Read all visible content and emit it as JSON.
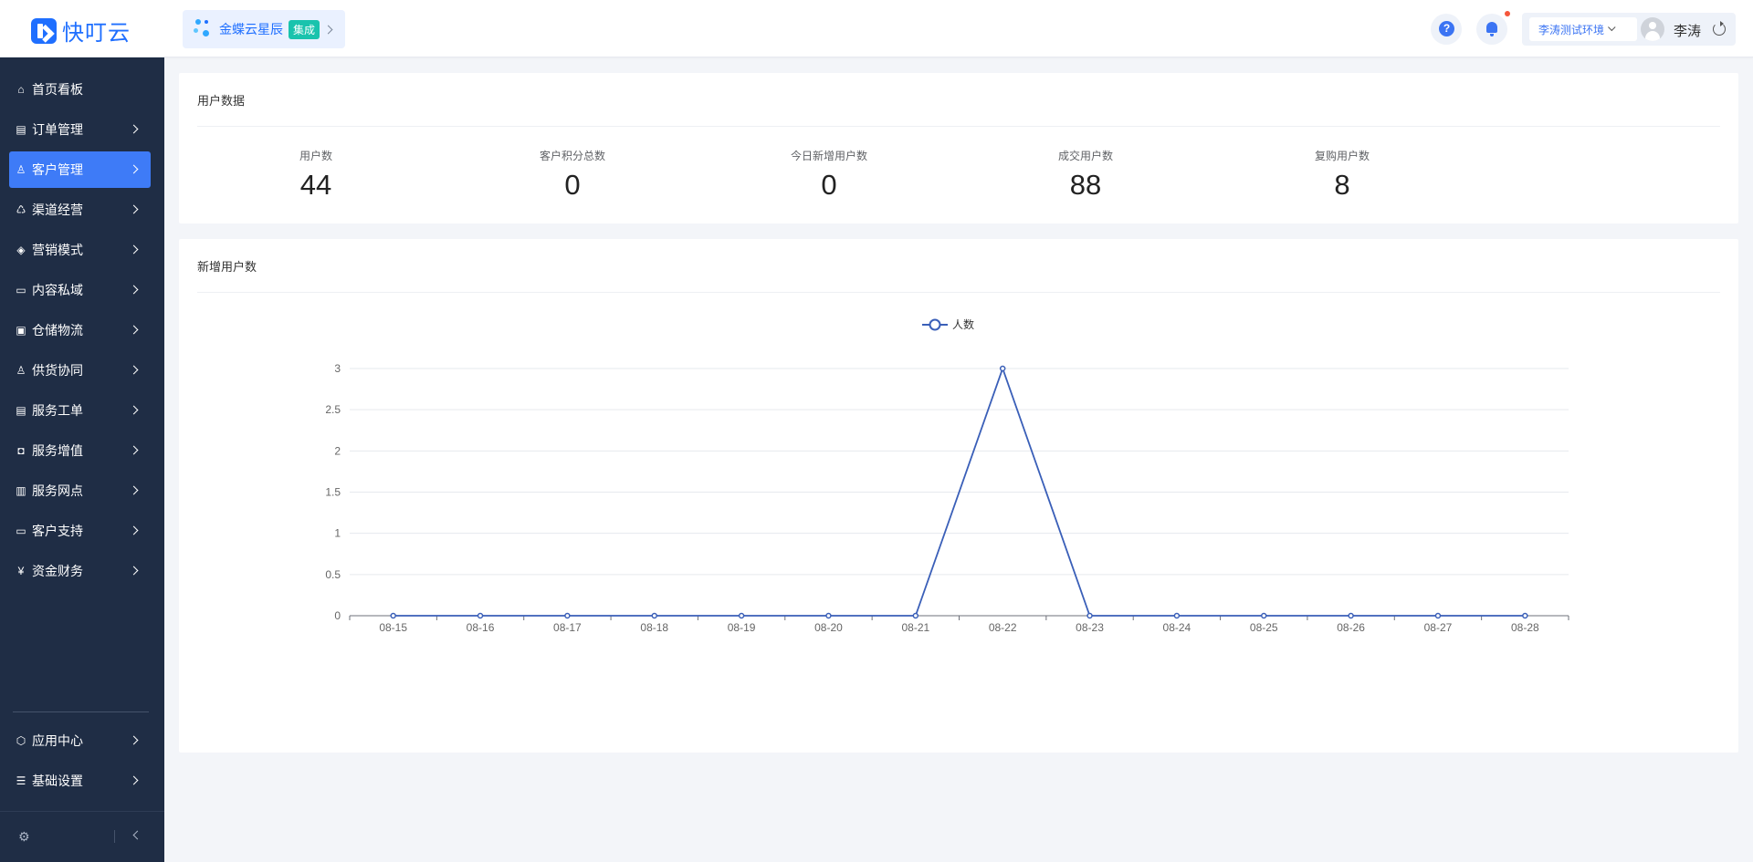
{
  "app": {
    "logo_text": "快叮云",
    "brand": {
      "name": "金蝶云星辰",
      "tag": "集成"
    },
    "environment": "李涛测试环境",
    "user_name": "李涛"
  },
  "colors": {
    "accent": "#3e7bf7",
    "sidebar_bg": "#1f2d45",
    "line": "#3a5fb8",
    "badge": "#19c3ad",
    "notification": "#f5563b"
  },
  "sidebar": {
    "items": [
      {
        "label": "首页看板",
        "icon": "home-icon",
        "has_children": false
      },
      {
        "label": "订单管理",
        "icon": "order-icon",
        "has_children": true
      },
      {
        "label": "客户管理",
        "icon": "user-icon",
        "has_children": true,
        "active": true
      },
      {
        "label": "渠道经营",
        "icon": "channel-icon",
        "has_children": true
      },
      {
        "label": "营销模式",
        "icon": "tag-icon",
        "has_children": true
      },
      {
        "label": "内容私域",
        "icon": "image-icon",
        "has_children": true
      },
      {
        "label": "仓储物流",
        "icon": "box-icon",
        "has_children": true
      },
      {
        "label": "供货协同",
        "icon": "supplier-icon",
        "has_children": true
      },
      {
        "label": "服务工单",
        "icon": "ticket-icon",
        "has_children": true
      },
      {
        "label": "服务增值",
        "icon": "bag-icon",
        "has_children": true
      },
      {
        "label": "服务网点",
        "icon": "store-icon",
        "has_children": true
      },
      {
        "label": "客户支持",
        "icon": "support-icon",
        "has_children": true
      },
      {
        "label": "资金财务",
        "icon": "yuan-icon",
        "has_children": true
      }
    ],
    "bottom_items": [
      {
        "label": "应用中心",
        "icon": "cube-icon",
        "has_children": true
      },
      {
        "label": "基础设置",
        "icon": "settings-icon",
        "has_children": true
      }
    ]
  },
  "stats_card": {
    "title": "用户数据",
    "stats": [
      {
        "label": "用户数",
        "value": "44"
      },
      {
        "label": "客户积分总数",
        "value": "0"
      },
      {
        "label": "今日新增用户数",
        "value": "0"
      },
      {
        "label": "成交用户数",
        "value": "88"
      },
      {
        "label": "复购用户数",
        "value": "8"
      }
    ]
  },
  "chart_card": {
    "title": "新增用户数"
  },
  "chart_data": {
    "type": "line",
    "title": "",
    "xlabel": "",
    "ylabel": "",
    "ylim": [
      0,
      3
    ],
    "yticks": [
      "0",
      "0.5",
      "1",
      "1.5",
      "2",
      "2.5",
      "3"
    ],
    "legend_position": "top-center",
    "grid": true,
    "categories": [
      "08-15",
      "08-16",
      "08-17",
      "08-18",
      "08-19",
      "08-20",
      "08-21",
      "08-22",
      "08-23",
      "08-24",
      "08-25",
      "08-26",
      "08-27",
      "08-28"
    ],
    "series": [
      {
        "name": "人数",
        "color": "#3a5fb8",
        "values": [
          0,
          0,
          0,
          0,
          0,
          0,
          0,
          3,
          0,
          0,
          0,
          0,
          0,
          0
        ]
      }
    ]
  }
}
